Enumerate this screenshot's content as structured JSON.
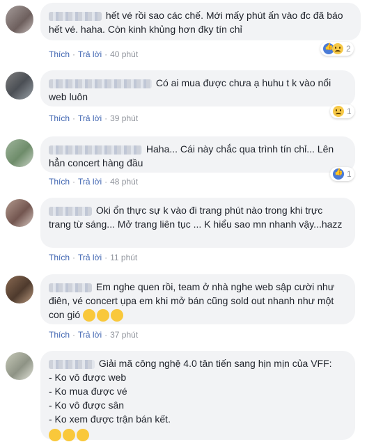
{
  "comments": [
    {
      "text": "hết vé rồi sao các chế. Mới mấy phút ấn vào đc đã báo hết vé. haha. Còn kinh khủng hơn đky tín chỉ",
      "like_label": "Thích",
      "reply_label": "Trả lời",
      "time": "40 phút",
      "reaction_count": "2",
      "reactions": [
        "like-icon",
        "sad-icon"
      ]
    },
    {
      "text": "Có ai mua được chưa ạ huhu t k vào nổi web luôn",
      "like_label": "Thích",
      "reply_label": "Trả lời",
      "time": "39 phút",
      "reaction_count": "1",
      "reactions": [
        "sad-icon"
      ]
    },
    {
      "text": "Haha... Cái này chắc qua trình tín chỉ... Lên hẳn concert hàng đầu",
      "like_label": "Thích",
      "reply_label": "Trả lời",
      "time": "48 phút",
      "reaction_count": "1",
      "reactions": [
        "like-icon"
      ]
    },
    {
      "text": "Oki ổn thực sự k vào đi trang phút nào trong khi trực trang từ sáng... Mở trang liên tục ... K hiểu sao mn nhanh vậy...hazz",
      "like_label": "Thích",
      "reply_label": "Trả lời",
      "time": "11 phút"
    },
    {
      "text": "Em nghe quen rồi, team ở nhà nghe web sập cười như điên, vé concert ụpa em khi mở bán cũng sold out nhanh như một con gió",
      "like_label": "Thích",
      "reply_label": "Trả lời",
      "time": "37 phút",
      "emojis": [
        "laughing-crying-emoji",
        "laughing-crying-emoji",
        "laughing-crying-emoji"
      ]
    },
    {
      "text": "Giải mã công nghệ 4.0 tân tiến sang hịn mịn của VFF:\n- Ko vô được web\n- Ko mua được vé\n- Ko vô được sân\n- Ko xem được trận bán kết.",
      "emojis": [
        "upside-down-face-emoji",
        "upside-down-face-emoji",
        "upside-down-face-emoji"
      ]
    }
  ],
  "colors": {
    "bubble": "#f2f3f5",
    "action_link": "#4267b2",
    "meta": "#90949c",
    "like": "#4a7bd6",
    "emoji": "#f7c948"
  }
}
